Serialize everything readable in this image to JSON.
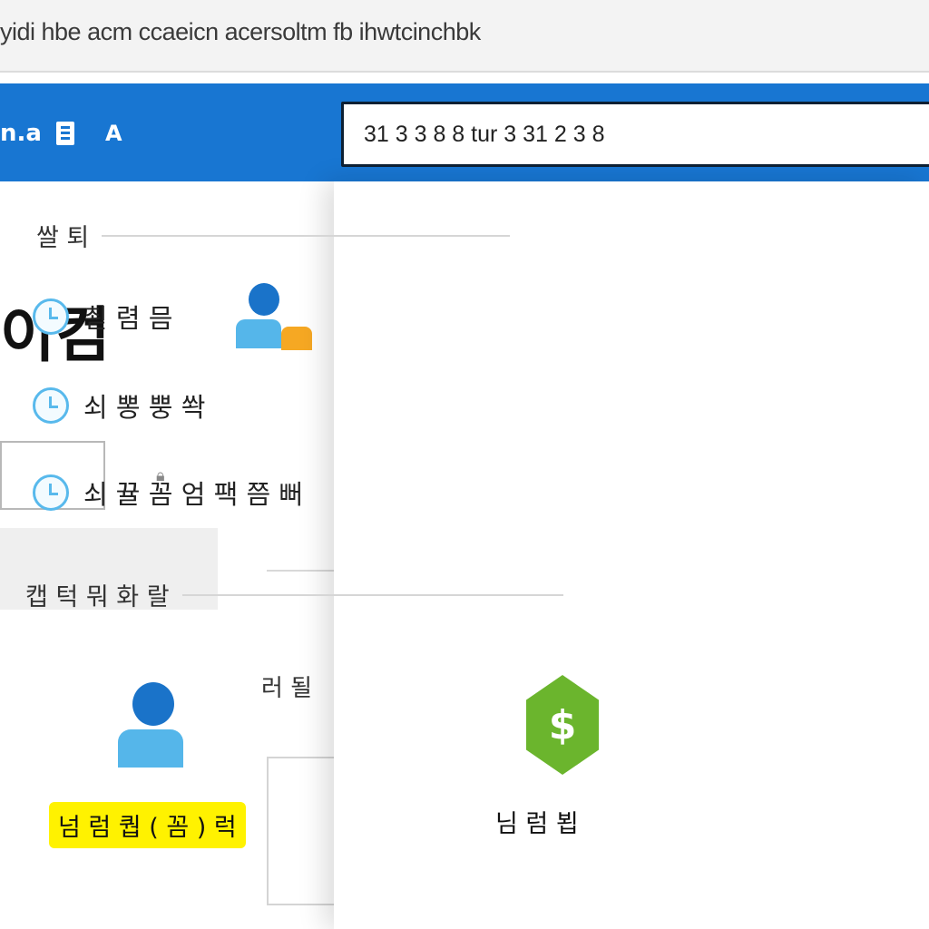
{
  "browser": {
    "url": "yidi hbe acm ccaeicn acersoltm fb ihwtcinchbk"
  },
  "header": {
    "app_name": "n.a",
    "secondary_label": "A"
  },
  "search": {
    "value": "31 3 3 8 8 tur 3 31 2 3 8"
  },
  "page": {
    "title": "이컴",
    "bg_text_fragment": "러 될"
  },
  "dropdown": {
    "recent_section_title": "쌀 퇴",
    "recent_items": [
      {
        "label": "쵣 렴 믐"
      },
      {
        "label": "쇠 뽕 뿡 쏵"
      },
      {
        "label": "쇠 뀰 꼼 엄 팩 쯤 뻐"
      }
    ],
    "apps_section_title": "캡 턱 뭐 화 랄",
    "apps": [
      {
        "label": "넘 럼 퀍 ( 꼼 ) 럭",
        "icon": "person-icon"
      },
      {
        "label": "님 럼 뵙",
        "icon": "money-hex-icon"
      }
    ]
  },
  "colors": {
    "header_blue": "#1876d2",
    "highlight_yellow": "#fff200",
    "clock_blue": "#58b9ec",
    "money_green": "#6bb52d"
  }
}
